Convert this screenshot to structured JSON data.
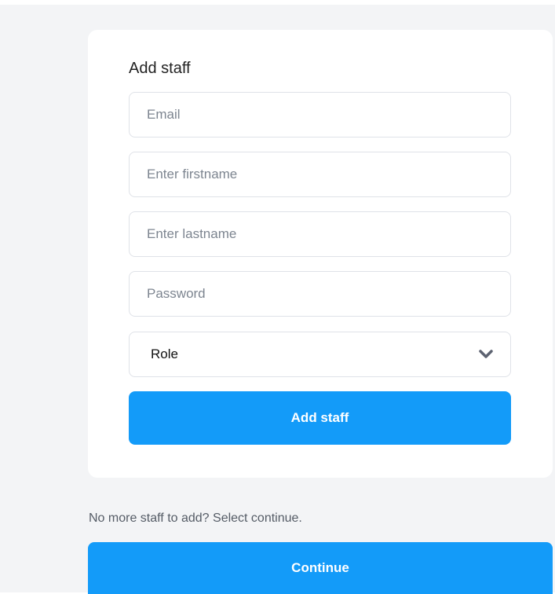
{
  "form": {
    "title": "Add staff",
    "email_placeholder": "Email",
    "firstname_placeholder": "Enter firstname",
    "lastname_placeholder": "Enter lastname",
    "password_placeholder": "Password",
    "role_label": "Role",
    "submit_label": "Add staff"
  },
  "footer": {
    "hint": "No more staff to add? Select continue.",
    "continue_label": "Continue"
  },
  "colors": {
    "primary": "#139bf9",
    "background": "#f3f4f6",
    "border": "#dfe2e8",
    "chevron": "#5c6270"
  },
  "icons": {
    "role_select": "chevron-down-icon"
  }
}
